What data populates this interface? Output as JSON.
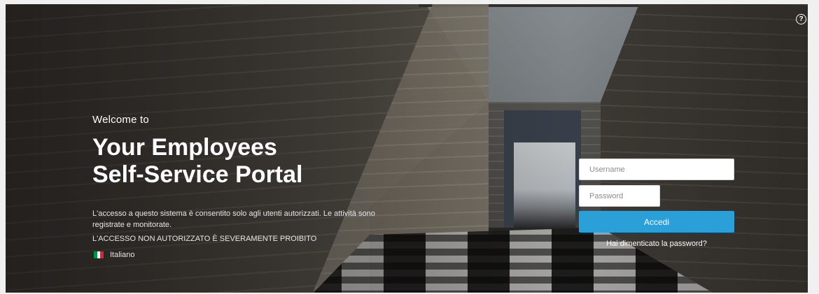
{
  "hero": {
    "welcome": "Welcome to",
    "title_line1": "Your Employees",
    "title_line2": "Self-Service Portal",
    "notice": "L'accesso a questo sistema è consentito solo agli utenti autorizzati. Le attività sono registrate e monitorate.",
    "notice_strong": "L'ACCESSO NON AUTORIZZATO È SEVERAMENTE PROIBITO"
  },
  "language": {
    "selected": "Italiano",
    "flag_colors": [
      "#009246",
      "#ffffff",
      "#ce2b37"
    ]
  },
  "login": {
    "username_placeholder": "Username",
    "password_placeholder": "Password",
    "submit_label": "Accedi",
    "forgot_label": "Hai dimenticato la password?"
  },
  "help": {
    "icon": "help-circle-icon",
    "glyph": "?"
  },
  "colors": {
    "accent": "#2a9fd8"
  }
}
